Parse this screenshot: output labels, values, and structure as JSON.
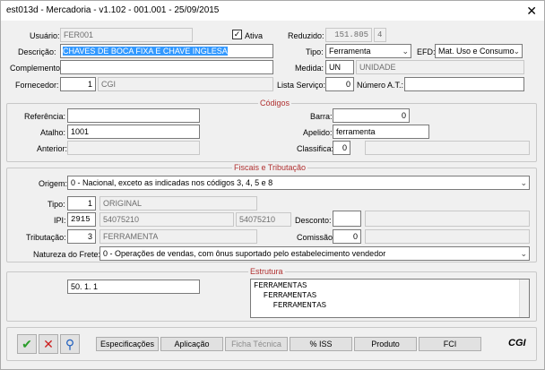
{
  "window": {
    "title": "est013d - Mercadoria - v1.102 - 001.001 - 25/09/2015",
    "close": "✕"
  },
  "top": {
    "usuario_label": "Usuário:",
    "usuario": "FER001",
    "ativa_label": "Ativa",
    "ativa_check": "✓",
    "reduzido_label": "Reduzido:",
    "reduzido": "151.805",
    "reduzido_dv": "4",
    "descricao_label": "Descrição:",
    "descricao": "CHAVES DE BOCA FIXA E CHAVE INGLESA",
    "tipo_label": "Tipo:",
    "tipo": "Ferramenta",
    "efd_label": "EFD:",
    "efd": "Mat. Uso e Consumo",
    "complemento_label": "Complemento:",
    "complemento": "",
    "medida_label": "Medida:",
    "medida": "UN",
    "medida_desc": "UNIDADE",
    "fornecedor_label": "Fornecedor:",
    "fornecedor": "1",
    "fornecedor_nome": "CGI",
    "lista_label": "Lista Serviço:",
    "lista": "0",
    "numero_label": "Número A.T.:",
    "numero": ""
  },
  "codigos": {
    "title": "Códigos",
    "referencia_label": "Referência:",
    "referencia": "",
    "barra_label": "Barra:",
    "barra": "0",
    "atalho_label": "Atalho:",
    "atalho": "1001",
    "apelido_label": "Apelido:",
    "apelido": "ferramenta",
    "anterior_label": "Anterior:",
    "anterior": "",
    "classifica_label": "Classifica:",
    "classifica": "0",
    "classifica_desc": ""
  },
  "fiscais": {
    "title": "Fiscais e Tributação",
    "origem_label": "Origem:",
    "origem": "0 - Nacional, exceto as indicadas nos códigos 3, 4, 5 e 8",
    "tipo_label": "Tipo:",
    "tipo": "1",
    "tipo_desc": "ORIGINAL",
    "ipi_label": "IPI:",
    "ipi": "2915",
    "ipi_a": "54075210",
    "ipi_b": "54075210",
    "desconto_label": "Desconto:",
    "desconto": "",
    "tributacao_label": "Tributação:",
    "tributacao": "3",
    "tributacao_desc": "FERRAMENTA",
    "comissao_label": "Comissão:",
    "comissao": "0",
    "frete_label": "Natureza do Frete:",
    "frete": "0 - Operações de vendas, com ônus suportado pelo estabelecimento vendedor"
  },
  "estrutura": {
    "title": "Estrutura",
    "code": "50. 1. 1",
    "tree": [
      "FERRAMENTAS",
      "  FERRAMENTAS",
      "    FERRAMENTAS"
    ]
  },
  "bottom": {
    "ok_icon": "checkmark-icon",
    "cancel_icon": "x-icon",
    "search_icon": "magnifier-icon",
    "buttons": [
      "Especificações",
      "Aplicação",
      "Ficha Técnica",
      "% ISS",
      "Produto",
      "FCI"
    ],
    "logo": "CGI"
  },
  "colors": {
    "group_title": "#b03030",
    "selection": "#3399ff"
  }
}
